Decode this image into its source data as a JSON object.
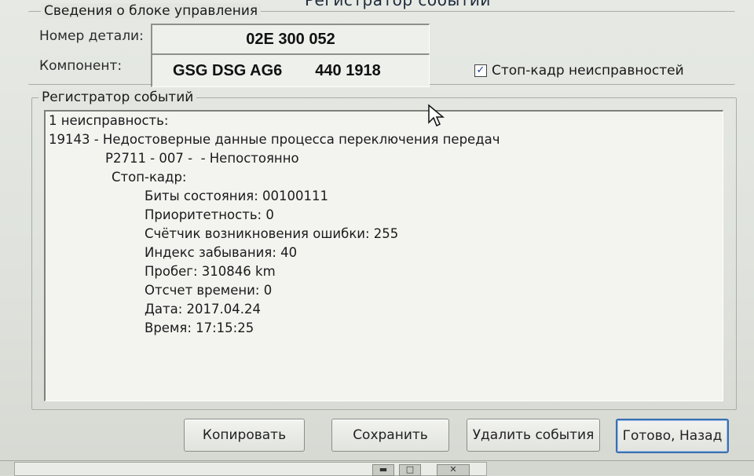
{
  "window": {
    "title": "Регистратор событий"
  },
  "ecu_group": {
    "legend": "Сведения о блоке управления",
    "part_number_label": "Номер детали:",
    "part_number_value": "02E 300 052",
    "component_label": "Компонент:",
    "component_value": "GSG DSG AG6",
    "component_code": "440 1918",
    "freeze_frame_checkbox": {
      "label": "Стоп-кадр неисправностей",
      "checked": true
    }
  },
  "event_group": {
    "legend": "Регистратор событий",
    "lines": [
      "1 неисправность:",
      "19143 - Недостоверные данные процесса переключения передач",
      "P2711 - 007 -  - Непостоянно",
      "Стоп-кадр:",
      "Биты состояния: 00100111",
      "Приоритетность: 0",
      "Счётчик возникновения ошибки: 255",
      "Индекс забывания: 40",
      "Пробег: 310846 km",
      "Отсчет времени: 0",
      "Дата: 2017.04.24",
      "Время: 17:15:25"
    ]
  },
  "buttons": {
    "copy": "Копировать",
    "save": "Сохранить",
    "delete": "Удалить события",
    "done": "Готово, Назад"
  },
  "taskbar": {
    "close_glyph": "✕",
    "minimize_glyph": "▬",
    "maximize_glyph": "□"
  },
  "colors": {
    "accent": "#3a6fb0",
    "check": "#1a3c8a"
  }
}
